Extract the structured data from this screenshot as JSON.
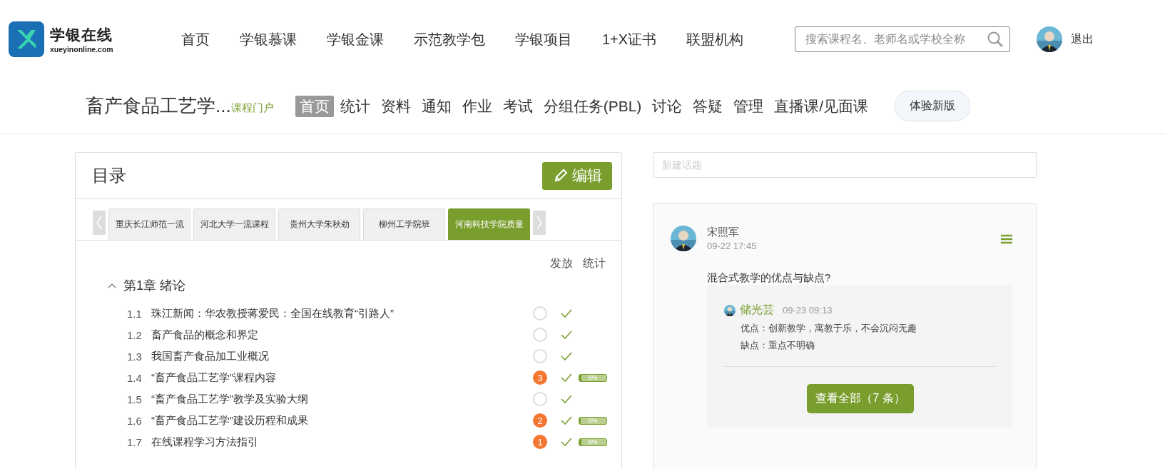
{
  "header": {
    "logo_title": "学银在线",
    "logo_subtitle": "xueyinonline.com",
    "nav": [
      {
        "label": "首页"
      },
      {
        "label": "学银慕课"
      },
      {
        "label": "学银金课"
      },
      {
        "label": "示范教学包"
      },
      {
        "label": "学银项目"
      },
      {
        "label": "1+X证书"
      },
      {
        "label": "联盟机构"
      }
    ],
    "search": {
      "placeholder": "搜索课程名、老师名或学校全称"
    },
    "logout": "退出"
  },
  "course": {
    "title": "畜产食品工艺学...",
    "portal": "课程门户",
    "tabs": [
      {
        "label": "首页",
        "selected": true
      },
      {
        "label": "统计",
        "selected": false
      },
      {
        "label": "资料",
        "selected": false
      },
      {
        "label": "通知",
        "selected": false
      },
      {
        "label": "作业",
        "selected": false
      },
      {
        "label": "考试",
        "selected": false
      },
      {
        "label": "分组任务(PBL)",
        "selected": false
      },
      {
        "label": "讨论",
        "selected": false
      },
      {
        "label": "答疑",
        "selected": false
      },
      {
        "label": "管理",
        "selected": false
      },
      {
        "label": "直播课/见面课",
        "selected": false
      }
    ],
    "new_version": "体验新版"
  },
  "catalog": {
    "title": "目录",
    "edit": "编辑",
    "classes": [
      {
        "label": "重庆长江师范一流",
        "selected": false
      },
      {
        "label": "河北大学一流课程",
        "selected": false
      },
      {
        "label": "贵州大学朱秋劲",
        "selected": false
      },
      {
        "label": "柳州工学院班",
        "selected": false
      },
      {
        "label": "河南科技学院质量",
        "selected": true
      }
    ],
    "columns": [
      "发放",
      "统计"
    ],
    "chapters": [
      {
        "title": "第1章 绪论",
        "expanded": true,
        "children": [
          {
            "number": "1.1",
            "title": "珠江新闻：华农教授蒋爱民：全国在线教育“引路人”"
          },
          {
            "number": "1.2",
            "title": "畜产食品的概念和界定"
          },
          {
            "number": "1.3",
            "title": "我国畜产食品加工业概况"
          },
          {
            "number": "1.4",
            "title": "“畜产食品工艺学”课程内容",
            "count": "3",
            "level": 0.08,
            "reading": "8%"
          },
          {
            "number": "1.5",
            "title": "“畜产食品工艺学”教学及实验大纲"
          },
          {
            "number": "1.6",
            "title": "“畜产食品工艺学”建设历程和成果",
            "count": "2",
            "level": 0.06,
            "reading": "6%"
          },
          {
            "number": "1.7",
            "title": "在线课程学习方法指引",
            "count": "1",
            "level": 0.08,
            "reading": "8%"
          }
        ]
      }
    ]
  },
  "discussion": {
    "new_topic": {
      "placeholder": "新建话题"
    },
    "topic": {
      "author": "宋照军",
      "time": "09-22 17:45",
      "question": "混合式教学的优点与缺点?",
      "reply": {
        "author": "储光芸",
        "time": "09-23 09:13",
        "lines": [
          "优点：创新教学，寓教于乐，不会沉闷无趣",
          "缺点：重点不明确"
        ]
      },
      "view_all": "查看全部（7 条）"
    }
  }
}
